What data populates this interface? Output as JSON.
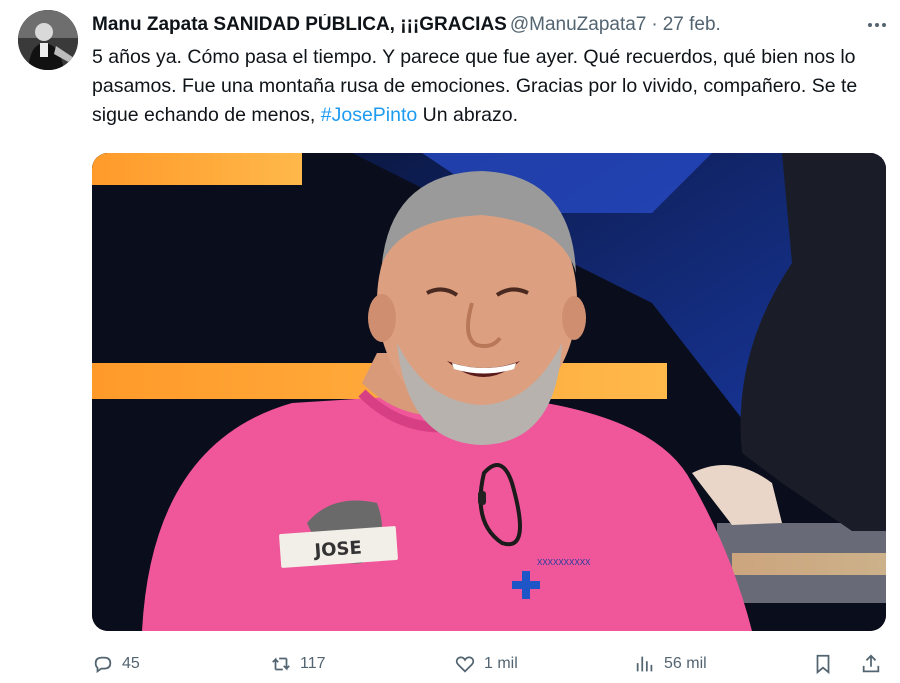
{
  "author": {
    "display_name": "Manu Zapata SANIDAD PÚBLICA, ¡¡¡GRACIAS",
    "handle": "@ManuZapata7",
    "separator": "·",
    "date": "27 feb."
  },
  "tweet": {
    "text_before": "5 años ya. Cómo pasa el tiempo. Y parece que fue ayer. Qué recuerdos, qué bien nos lo pasamos. Fue una montaña rusa de emociones. Gracias por lo vivido, compañero. Se te sigue echando de menos, ",
    "hashtag": "#JosePinto",
    "text_after": " Un abrazo."
  },
  "media": {
    "name_tag": "JOSE"
  },
  "actions": {
    "replies": "45",
    "retweets": "117",
    "likes": "1 mil",
    "views": "56 mil"
  },
  "colors": {
    "link": "#1d9bf0",
    "secondary_text": "#536471",
    "shirt": "#f0569a"
  },
  "icons": {
    "more": "more-icon",
    "reply": "reply-icon",
    "retweet": "retweet-icon",
    "like": "heart-icon",
    "views": "views-icon",
    "bookmark": "bookmark-icon",
    "share": "share-icon"
  }
}
